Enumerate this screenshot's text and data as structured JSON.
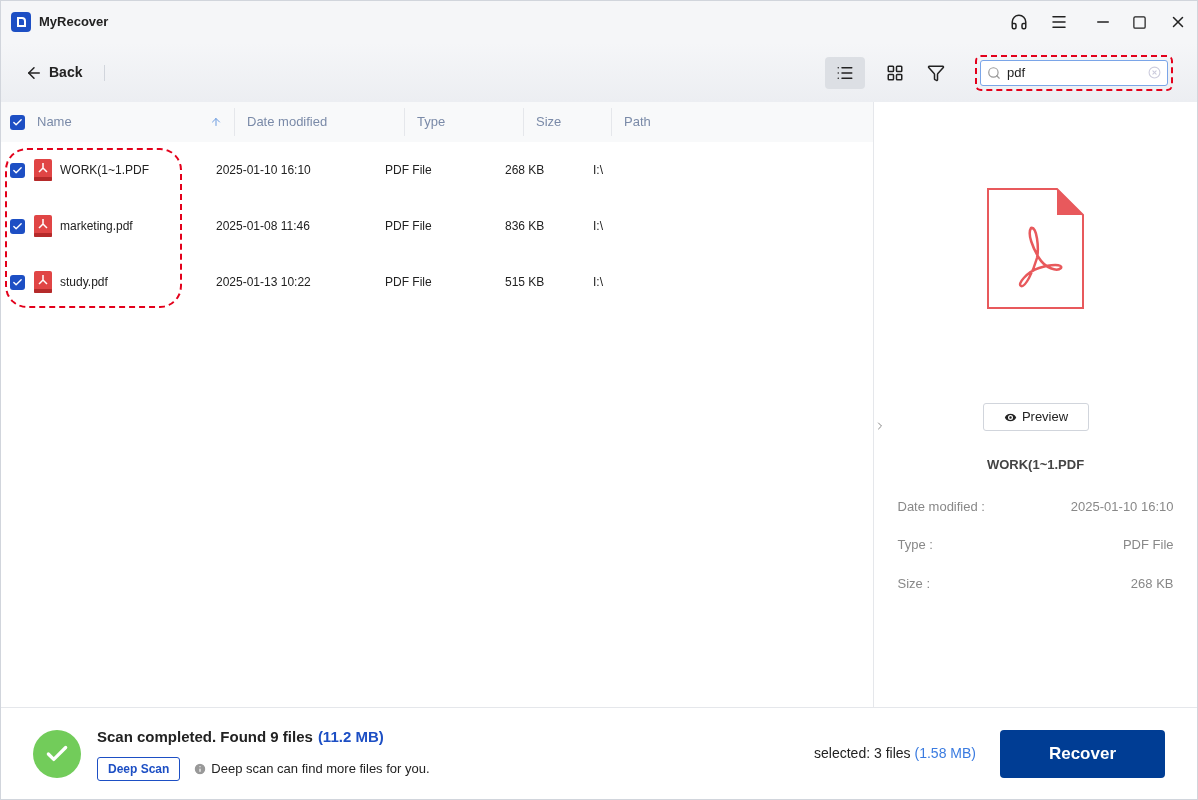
{
  "window": {
    "title": "MyRecover"
  },
  "toolbar": {
    "back": "Back",
    "views": [
      {
        "kind": "list",
        "selected": true
      },
      {
        "kind": "grid",
        "selected": false
      }
    ],
    "search": {
      "value": "pdf",
      "highlighted": true
    }
  },
  "table": {
    "all_checked": true,
    "name_column_highlighted": true,
    "columns": [
      {
        "label": "Name",
        "sorted": true
      },
      {
        "label": "Date modified",
        "sorted": false
      },
      {
        "label": "Type",
        "sorted": false
      },
      {
        "label": "Size",
        "sorted": false
      },
      {
        "label": "Path",
        "sorted": false
      }
    ],
    "rows": [
      {
        "checked": true,
        "name": "WORK(1~1.PDF",
        "date": "2025-01-10 16:10",
        "type": "PDF File",
        "size": "268 KB",
        "path": "I:\\"
      },
      {
        "checked": true,
        "name": "marketing.pdf",
        "date": "2025-01-08 11:46",
        "type": "PDF File",
        "size": "836 KB",
        "path": "I:\\"
      },
      {
        "checked": true,
        "name": "study.pdf",
        "date": "2025-01-13 10:22",
        "type": "PDF File",
        "size": "515 KB",
        "path": "I:\\"
      }
    ]
  },
  "details": {
    "preview_button": "Preview",
    "file_name": "WORK(1~1.PDF",
    "fields": [
      {
        "label": "Date modified :",
        "value": "2025-01-10 16:10"
      },
      {
        "label": "Type :",
        "value": "PDF File"
      },
      {
        "label": "Size :",
        "value": "268 KB"
      }
    ]
  },
  "status": {
    "message": "Scan completed. Found 9 files",
    "size": "(11.2 MB)",
    "deep_scan": "Deep Scan",
    "hint": "Deep scan can find more files for you.",
    "selected": "selected: 3 files",
    "selected_size": "(1.58 MB)",
    "recover": "Recover"
  }
}
